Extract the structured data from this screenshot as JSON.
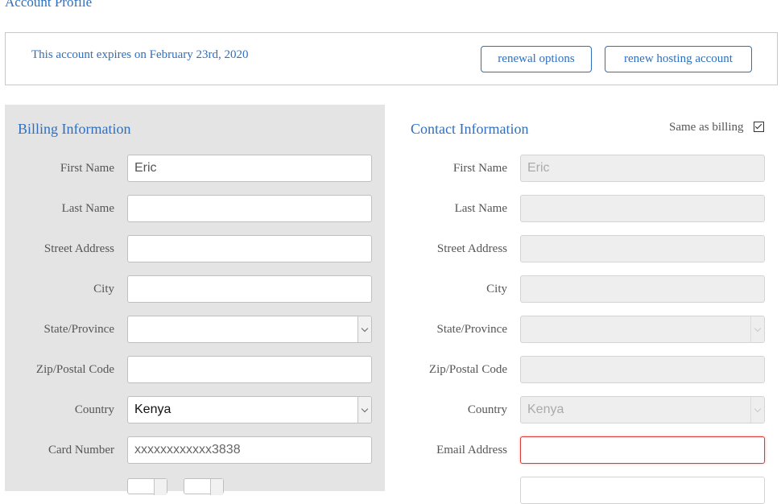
{
  "page": {
    "title": "Account Profile"
  },
  "expiry": {
    "text": "This account expires on February 23rd, 2020",
    "renewal_options_label": "renewal options",
    "renew_hosting_label": "renew hosting account"
  },
  "billing": {
    "title": "Billing Information",
    "labels": {
      "first_name": "First Name",
      "last_name": "Last Name",
      "street_address": "Street Address",
      "city": "City",
      "state": "State/Province",
      "zip": "Zip/Postal Code",
      "country": "Country",
      "card_number": "Card Number"
    },
    "values": {
      "first_name": "Eric",
      "last_name": "",
      "street_address": "",
      "city": "",
      "state": "",
      "zip": "",
      "country": "Kenya",
      "card_number": "xxxxxxxxxxxx3838"
    }
  },
  "contact": {
    "title": "Contact Information",
    "same_as_billing_label": "Same as billing",
    "same_as_billing_checked": true,
    "labels": {
      "first_name": "First Name",
      "last_name": "Last Name",
      "street_address": "Street Address",
      "city": "City",
      "state": "State/Province",
      "zip": "Zip/Postal Code",
      "country": "Country",
      "email": "Email Address"
    },
    "values": {
      "first_name": "Eric",
      "last_name": "",
      "street_address": "",
      "city": "",
      "state": "",
      "zip": "",
      "country": "Kenya",
      "email": ""
    }
  },
  "colors": {
    "accent": "#2f6fbe",
    "error_border": "#d93b3b",
    "panel_bg": "#e4e4e4",
    "disabled_bg": "#eeeeee"
  }
}
